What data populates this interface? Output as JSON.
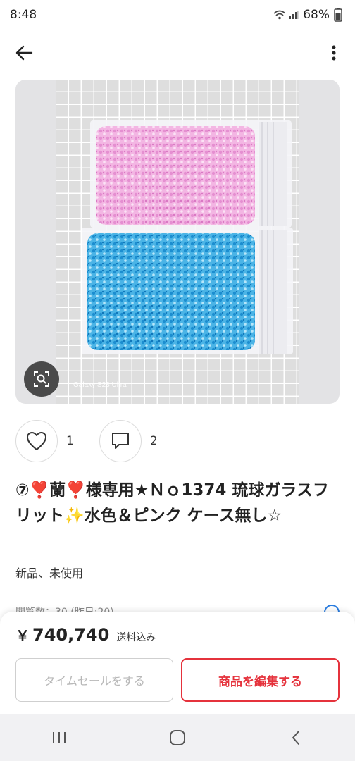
{
  "status": {
    "time": "8:48",
    "battery": "68%"
  },
  "photo": {
    "watermark": "Galaxy S23 Ultra"
  },
  "actions": {
    "likes": "1",
    "comments": "2"
  },
  "item": {
    "title": "⑦❣️蘭❣️様専用★Ｎｏ1374 琉球ガラスフリット✨水色＆ピンク ケース無し☆",
    "condition": "新品、未使用",
    "peek_text": "閲覧数：30 (昨日:20)"
  },
  "price": {
    "currency": "￥",
    "value": "740,740",
    "note": "送料込み"
  },
  "buttons": {
    "timesale": "タイムセールをする",
    "edit": "商品を編集する"
  },
  "colors": {
    "accent": "#e5323c",
    "pink_glass": "#f2a9dc",
    "blue_glass": "#3aa8e0"
  }
}
